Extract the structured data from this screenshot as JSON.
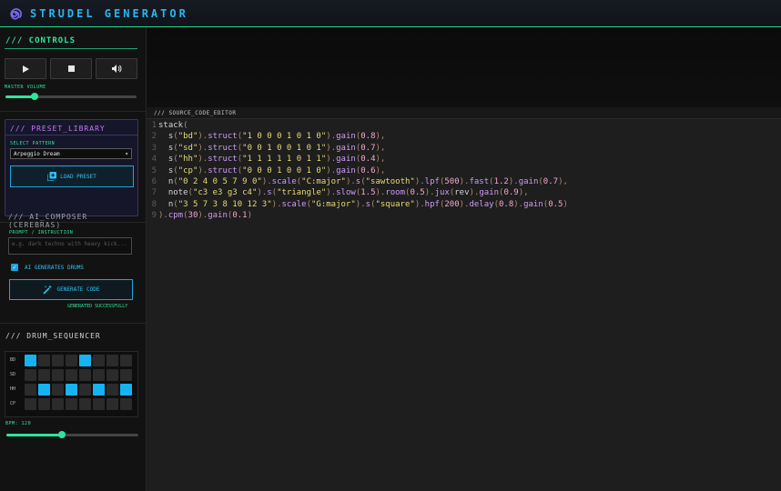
{
  "app": {
    "title": "STRUDEL GENERATOR"
  },
  "controls": {
    "title": "/// CONTROLS",
    "master_volume_label": "MASTER VOLUME",
    "master_volume": 0.22
  },
  "preset": {
    "title": "/// PRESET_LIBRARY",
    "select_label": "SELECT PATTERN",
    "selected": "Arpeggio Dream",
    "load_label": "LOAD PRESET"
  },
  "composer": {
    "title": "/// AI_COMPOSER (CEREBRAS)",
    "prompt_label": "PROMPT / INSTRUCTION",
    "prompt_placeholder": "e.g. dark techno with heavy kick...",
    "checkbox_label": "AI GENERATES DRUMS",
    "checkbox_checked": true,
    "generate_label": "GENERATE CODE",
    "status": "GENERATED SUCCESSFULLY"
  },
  "drum": {
    "title": "/// DRUM_SEQUENCER",
    "rows": [
      {
        "label": "BD",
        "steps": [
          1,
          0,
          0,
          0,
          1,
          0,
          0,
          0
        ]
      },
      {
        "label": "SD",
        "steps": [
          0,
          0,
          0,
          0,
          0,
          0,
          0,
          0
        ]
      },
      {
        "label": "HH",
        "steps": [
          0,
          1,
          0,
          1,
          0,
          1,
          0,
          1
        ]
      },
      {
        "label": "CP",
        "steps": [
          0,
          0,
          0,
          0,
          0,
          0,
          0,
          0
        ]
      }
    ],
    "bpm_label": "BPM: 120",
    "bpm_level": 0.42,
    "accent": "#16b3f2"
  },
  "editor": {
    "title": "/// SOURCE_CODE_EDITOR",
    "lines": [
      "stack(",
      "  s(\"bd\").struct(\"1 0 0 0 1 0 1 0\").gain(0.8),",
      "  s(\"sd\").struct(\"0 0 1 0 0 1 0 1\").gain(0.7),",
      "  s(\"hh\").struct(\"1 1 1 1 1 0 1 1\").gain(0.4),",
      "  s(\"cp\").struct(\"0 0 0 1 0 0 1 0\").gain(0.6),",
      "  n(\"0 2 4 0 5 7 9 0\").scale(\"C:major\").s(\"sawtooth\").lpf(500).fast(1.2).gain(0.7),",
      "  note(\"c3 e3 g3 c4\").s(\"triangle\").slow(1.5).room(0.5).jux(rev).gain(0.9),",
      "  n(\"3 5 7 3 8 10 12 3\").scale(\"G:major\").s(\"square\").hpf(200).delay(0.8).gain(0.5)",
      ").cpm(30).gain(0.1)"
    ]
  },
  "colors": {
    "accent_green": "#2ee59d",
    "accent_blue": "#26b6f0",
    "accent_purple": "#c27cf0"
  }
}
